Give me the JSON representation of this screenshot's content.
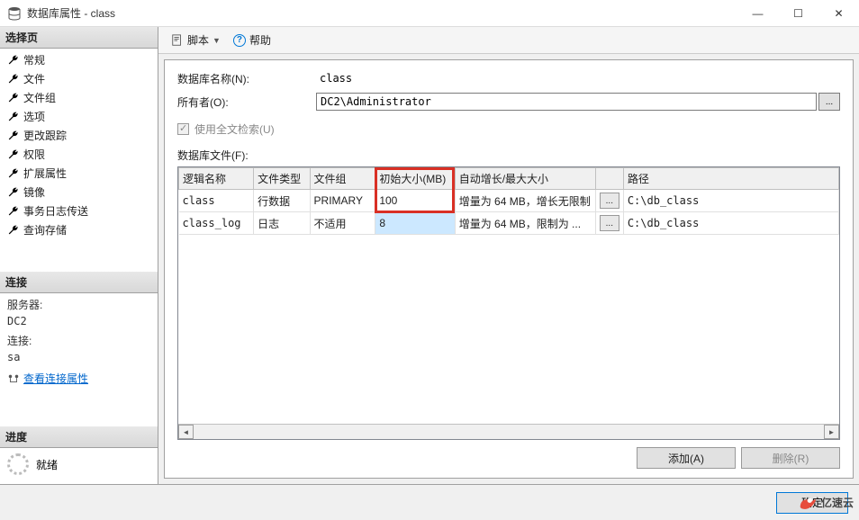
{
  "window": {
    "title": "数据库属性 - class",
    "min": "—",
    "max": "☐",
    "close": "✕"
  },
  "sidebar": {
    "select_header": "选择页",
    "items": [
      "常规",
      "文件",
      "文件组",
      "选项",
      "更改跟踪",
      "权限",
      "扩展属性",
      "镜像",
      "事务日志传送",
      "查询存储"
    ],
    "conn_header": "连接",
    "server_label": "服务器:",
    "server_value": "DC2",
    "conn_label": "连接:",
    "conn_value": "sa",
    "view_conn_props": "查看连接属性",
    "progress_header": "进度",
    "ready": "就绪"
  },
  "toolbar": {
    "script": "脚本",
    "help": "帮助"
  },
  "form": {
    "dbname_label": "数据库名称(N):",
    "dbname_value": "class",
    "owner_label": "所有者(O):",
    "owner_value": "DC2\\Administrator",
    "fulltext_label": "使用全文检索(U)",
    "files_label": "数据库文件(F):"
  },
  "grid": {
    "headers": [
      "逻辑名称",
      "文件类型",
      "文件组",
      "初始大小(MB)",
      "自动增长/最大大小",
      "",
      "路径"
    ],
    "col_widths": [
      "80px",
      "60px",
      "70px",
      "85px",
      "150px",
      "30px",
      "230px"
    ],
    "rows": [
      {
        "name": "class",
        "ftype": "行数据",
        "fgroup": "PRIMARY",
        "initsize": "100",
        "autogrow": "增量为 64 MB，增长无限制",
        "btn": "...",
        "path": "C:\\db_class",
        "selected_col": null
      },
      {
        "name": "class_log",
        "ftype": "日志",
        "fgroup": "不适用",
        "initsize": "8",
        "autogrow": "增量为 64 MB，限制为 ...",
        "btn": "...",
        "path": "C:\\db_class",
        "selected_col": 3
      }
    ]
  },
  "buttons": {
    "add": "添加(A)",
    "remove": "删除(R)",
    "ok": "确定"
  },
  "watermark": "亿速云"
}
